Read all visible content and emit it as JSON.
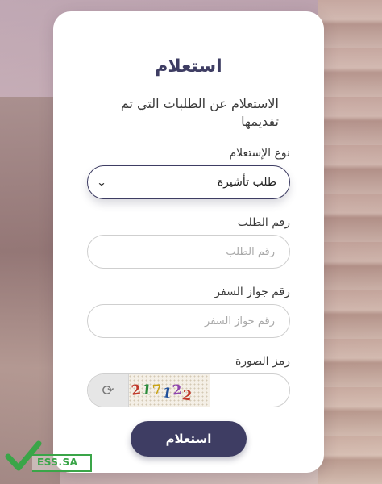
{
  "form": {
    "title": "استعلام",
    "subtitle": "الاستعلام عن الطلبات التي تم تقديمها",
    "inquiry_type": {
      "label": "نوع الإستعلام",
      "selected": "طلب تأشيرة"
    },
    "request_number": {
      "label": "رقم الطلب",
      "placeholder": "رقم الطلب"
    },
    "passport_number": {
      "label": "رقم جواز السفر",
      "placeholder": "رقم جواز السفر"
    },
    "captcha": {
      "label": "رمز الصورة",
      "chars": [
        "2",
        "1",
        "7",
        "1",
        "2",
        "2"
      ],
      "char_colors": [
        "#c0392b",
        "#2a8a3a",
        "#c9a414",
        "#1f4f9a",
        "#8e44ad",
        "#c0392b"
      ],
      "refresh_icon": "refresh-icon"
    },
    "submit_label": "استعلام"
  },
  "watermark": {
    "text": "ESS.SA",
    "icon": "checkmark-icon",
    "color": "#3aa548"
  },
  "colors": {
    "primary": "#3e3d63",
    "card": "#ffffff"
  }
}
